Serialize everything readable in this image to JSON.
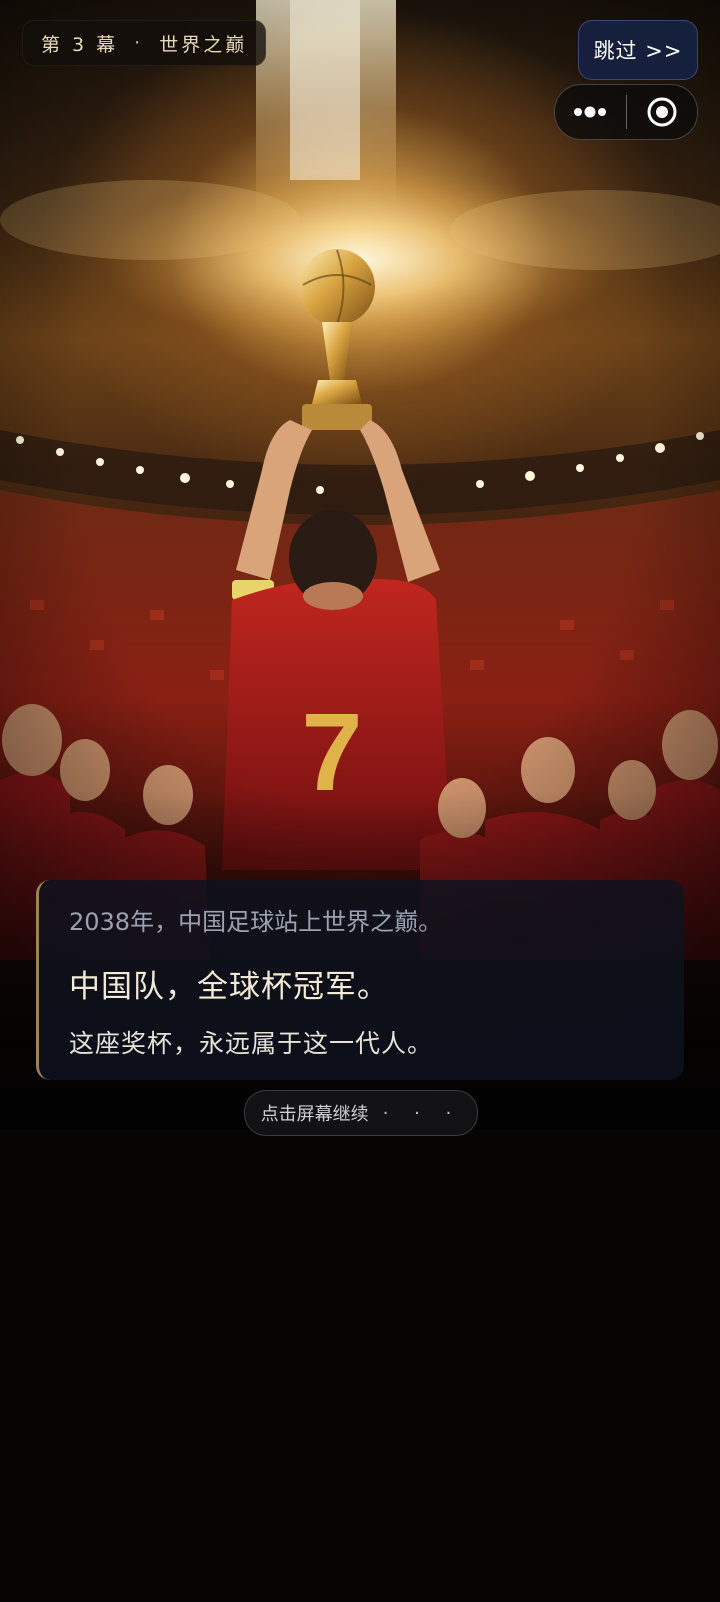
{
  "chapter": {
    "act": "第 3 幕",
    "separator": "·",
    "title": "世界之巅"
  },
  "controls": {
    "skip_label": "跳过 >>",
    "more_icon": "more-dots-icon",
    "close_icon": "target-circle-icon"
  },
  "dialog": {
    "line1": "2038年，中国足球站上世界之巅。",
    "line2": "中国队，全球杯冠军。",
    "line3": "这座奖杯，永远属于这一代人。"
  },
  "continue": {
    "label": "点击屏幕继续",
    "dots": "· · ·"
  },
  "scene": {
    "jersey_number": "7",
    "colors": {
      "gold": "#d8a64a",
      "jersey_red": "#a3161a",
      "crowd_red": "#7a1a12"
    }
  }
}
